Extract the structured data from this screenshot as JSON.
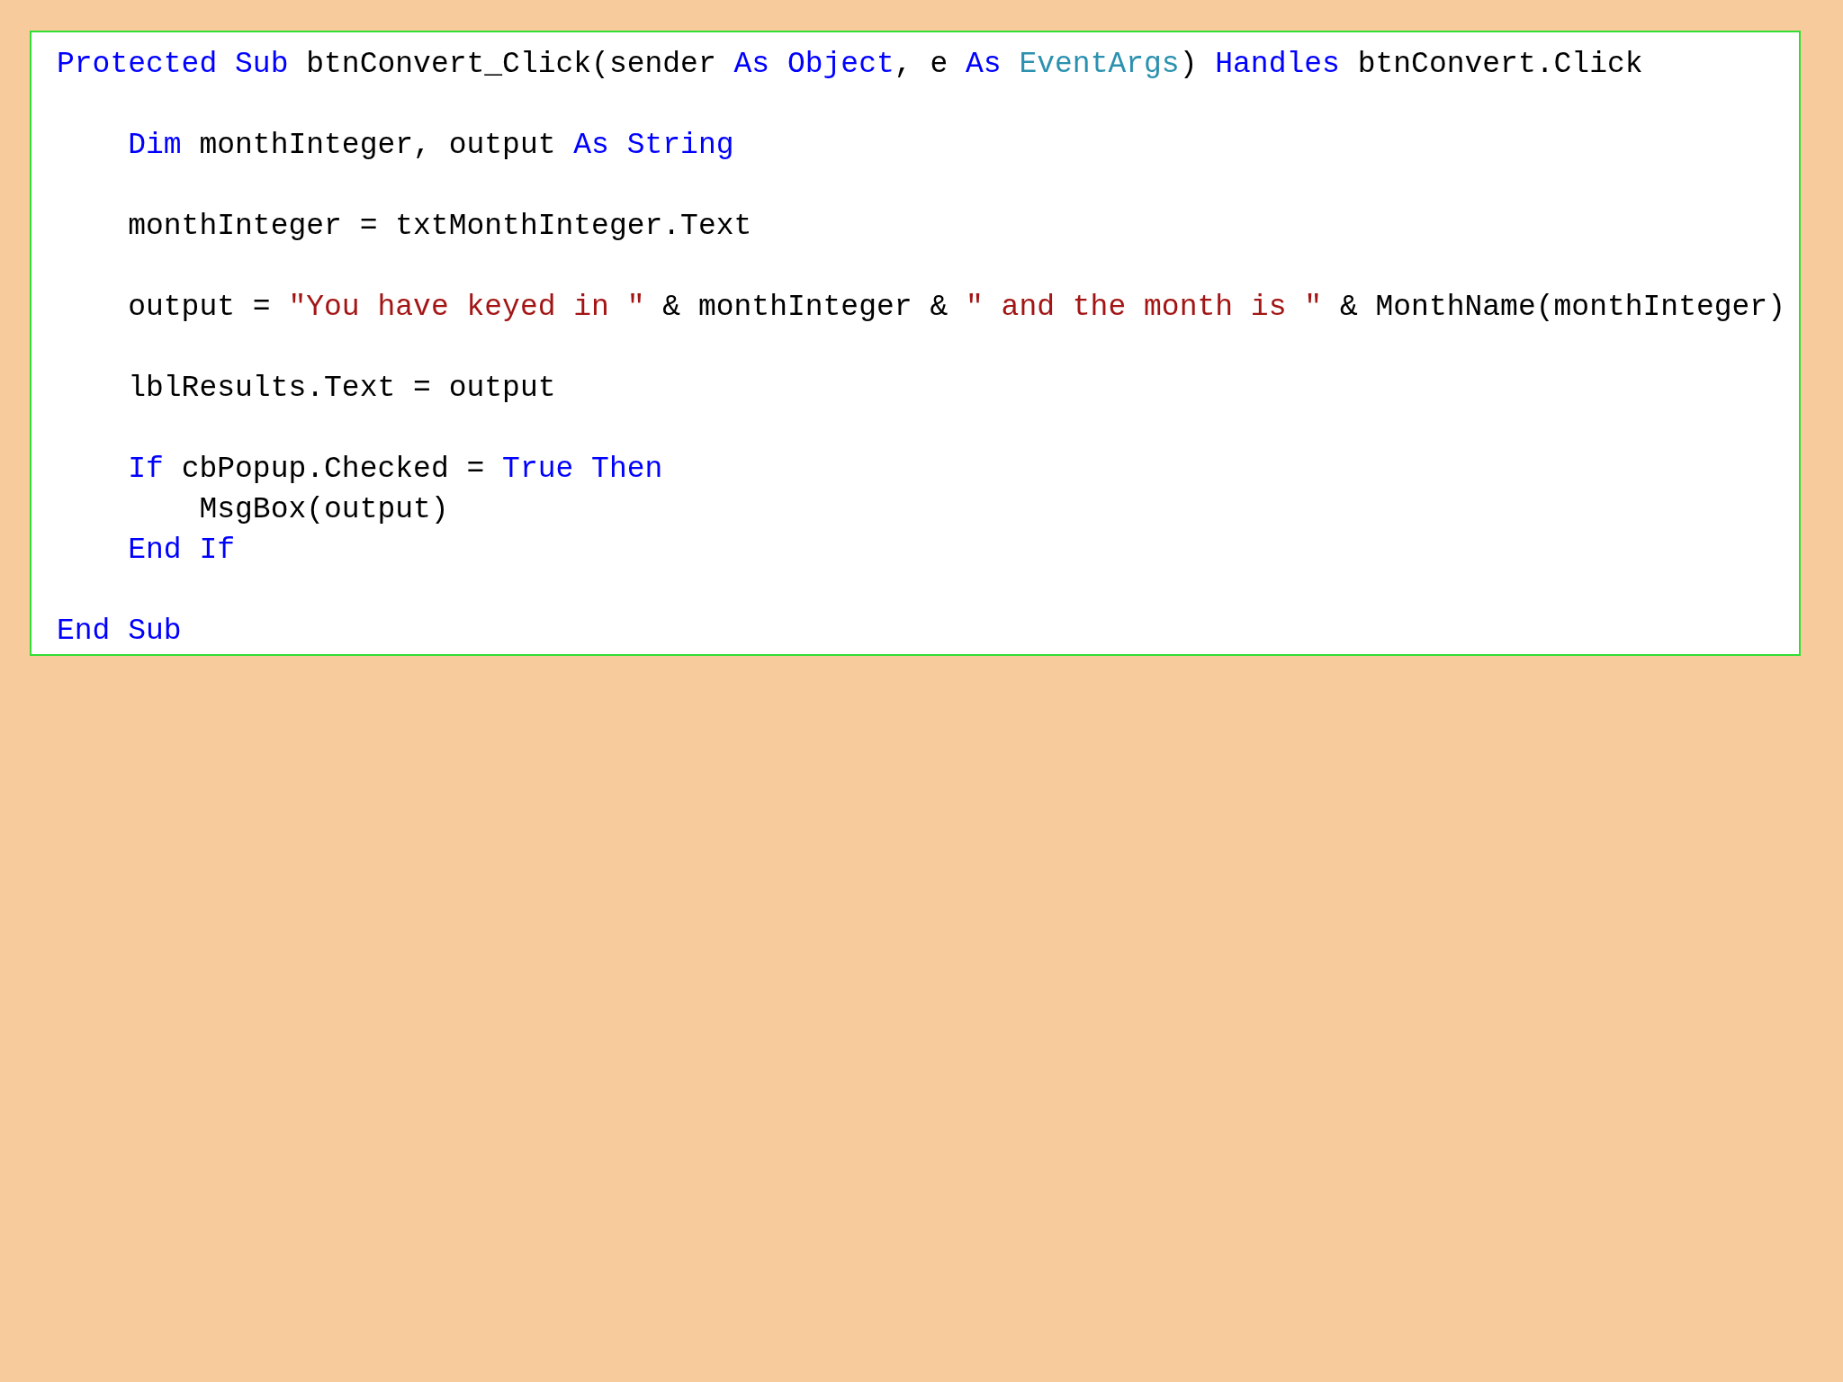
{
  "code_lines": [
    {
      "kind": "code",
      "tokens": [
        {
          "kind": "keyword",
          "text": "Protected Sub"
        },
        {
          "kind": "plain",
          "text": " btnConvert_Click(sender "
        },
        {
          "kind": "keyword",
          "text": "As Object"
        },
        {
          "kind": "plain",
          "text": ", e "
        },
        {
          "kind": "keyword",
          "text": "As "
        },
        {
          "kind": "type",
          "text": "EventArgs"
        },
        {
          "kind": "plain",
          "text": ") "
        },
        {
          "kind": "keyword",
          "text": "Handles"
        },
        {
          "kind": "plain",
          "text": " btnConvert.Click"
        }
      ]
    },
    {
      "kind": "blank"
    },
    {
      "kind": "code",
      "tokens": [
        {
          "kind": "keyword",
          "text": "    Dim"
        },
        {
          "kind": "plain",
          "text": " monthInteger, output "
        },
        {
          "kind": "keyword",
          "text": "As String"
        }
      ]
    },
    {
      "kind": "blank"
    },
    {
      "kind": "code",
      "tokens": [
        {
          "kind": "plain",
          "text": "    monthInteger = txtMonthInteger.Text"
        }
      ]
    },
    {
      "kind": "blank"
    },
    {
      "kind": "code",
      "tokens": [
        {
          "kind": "plain",
          "text": "    output = "
        },
        {
          "kind": "string",
          "text": "\"You have keyed in \""
        },
        {
          "kind": "plain",
          "text": " & monthInteger & "
        },
        {
          "kind": "string",
          "text": "\" and the month is \""
        },
        {
          "kind": "plain",
          "text": " & MonthName(monthInteger)"
        }
      ]
    },
    {
      "kind": "blank"
    },
    {
      "kind": "code",
      "tokens": [
        {
          "kind": "plain",
          "text": "    lblResults.Text = output"
        }
      ]
    },
    {
      "kind": "blank"
    },
    {
      "kind": "code",
      "tokens": [
        {
          "kind": "keyword",
          "text": "    If"
        },
        {
          "kind": "plain",
          "text": " cbPopup.Checked = "
        },
        {
          "kind": "keyword",
          "text": "True Then"
        }
      ]
    },
    {
      "kind": "code",
      "tokens": [
        {
          "kind": "plain",
          "text": "        MsgBox(output)"
        }
      ]
    },
    {
      "kind": "code",
      "tokens": [
        {
          "kind": "keyword",
          "text": "    End If"
        }
      ]
    },
    {
      "kind": "blank"
    },
    {
      "kind": "code",
      "tokens": [
        {
          "kind": "keyword",
          "text": "End Sub"
        }
      ]
    }
  ]
}
